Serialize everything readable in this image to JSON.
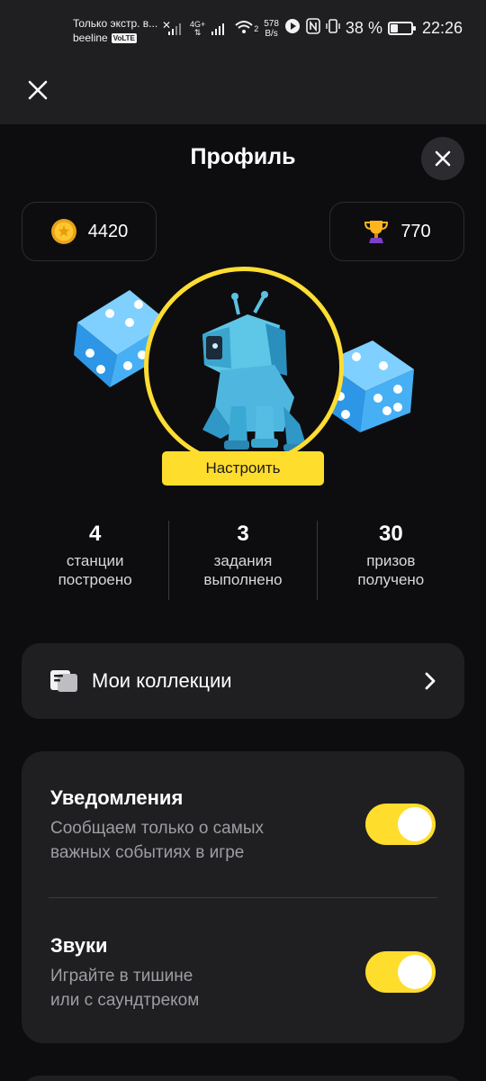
{
  "status_bar": {
    "notification_text": "Только экстр. в...",
    "carrier": "beeline",
    "volte": "VoLTE",
    "network": "4G+",
    "wifi_sub": "2",
    "speed_value": "578",
    "speed_unit": "B/s",
    "battery_percent": "38 %",
    "battery_level": 0.38,
    "time": "22:26"
  },
  "header": {
    "title": "Профиль"
  },
  "balances": {
    "coins": "4420",
    "trophies": "770"
  },
  "avatar": {
    "customize_label": "Настроить"
  },
  "stats": [
    {
      "value": "4",
      "label_line1": "станции",
      "label_line2": "построено"
    },
    {
      "value": "3",
      "label_line1": "задания",
      "label_line2": "выполнено"
    },
    {
      "value": "30",
      "label_line1": "призов",
      "label_line2": "получено"
    }
  ],
  "collections": {
    "label": "Мои коллекции"
  },
  "settings": {
    "notifications": {
      "title": "Уведомления",
      "desc_line1": "Сообщаем только о самых",
      "desc_line2": "важных событиях в игре",
      "enabled": true
    },
    "sounds": {
      "title": "Звуки",
      "desc_line1": "Играйте в тишине",
      "desc_line2": "или с саундтреком",
      "enabled": true
    }
  },
  "colors": {
    "accent": "#ffdd2d",
    "background": "#0d0d0f",
    "card": "#1f1f22",
    "muted_text": "#9d9da3"
  }
}
